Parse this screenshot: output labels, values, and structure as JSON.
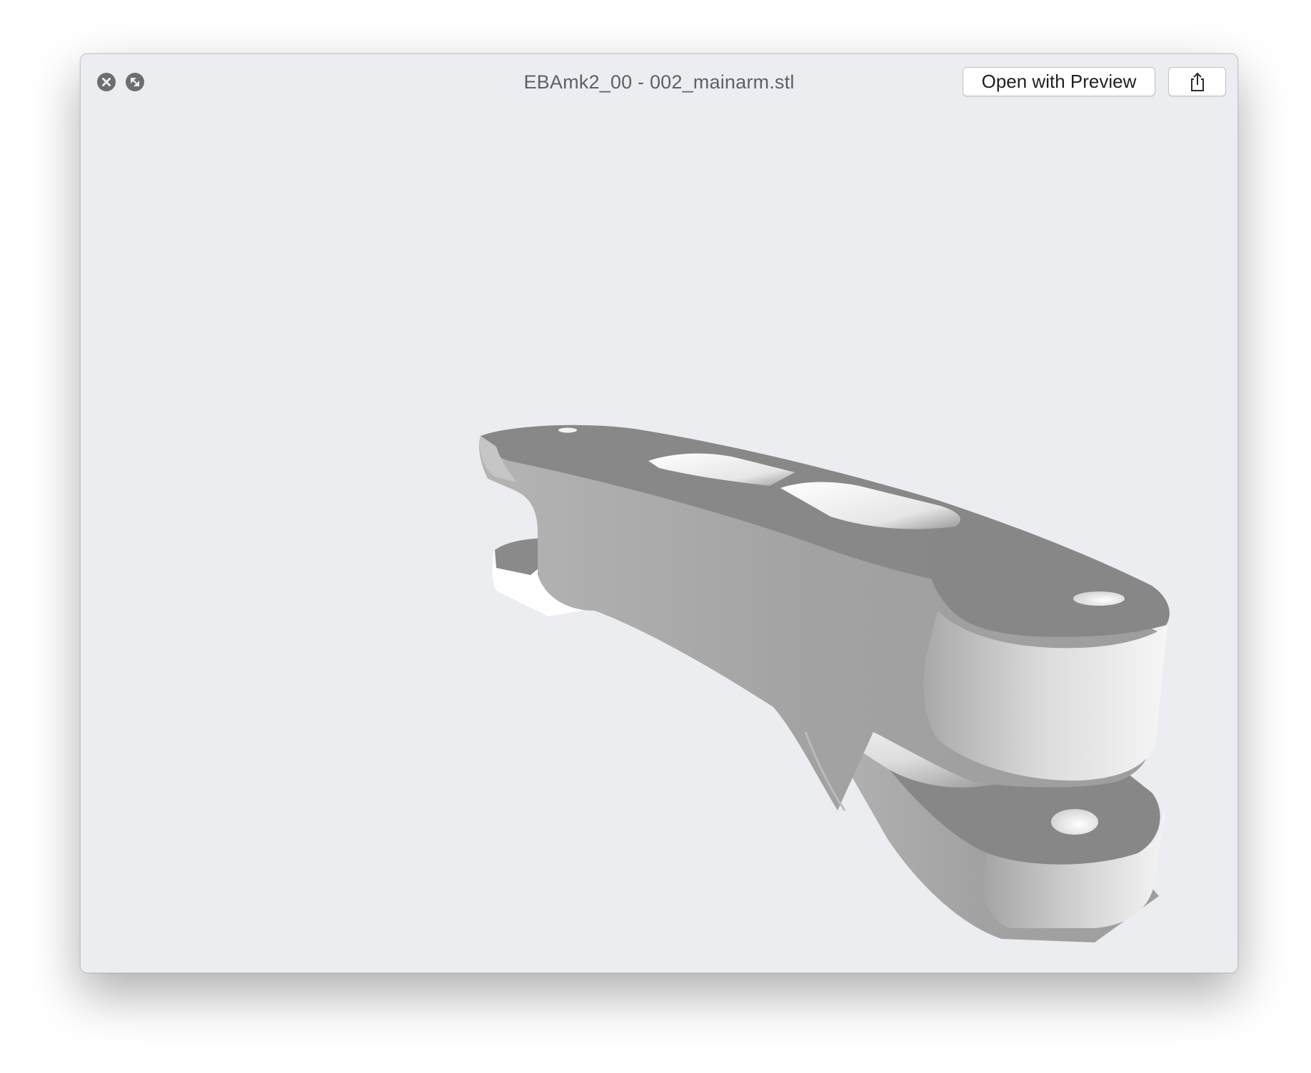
{
  "window": {
    "title": "EBAmk2_00 - 002_mainarm.stl"
  },
  "toolbar": {
    "open_with_label": "Open with Preview",
    "close_icon": "close-icon",
    "fullscreen_icon": "fullscreen-icon",
    "share_icon": "share-icon"
  },
  "viewer": {
    "model_name": "3d-model-mainarm",
    "colors": {
      "background": "#ecedf1",
      "model_top": "#888888",
      "model_side": "#a6a6a6",
      "model_highlight": "#f2f2f2"
    }
  }
}
